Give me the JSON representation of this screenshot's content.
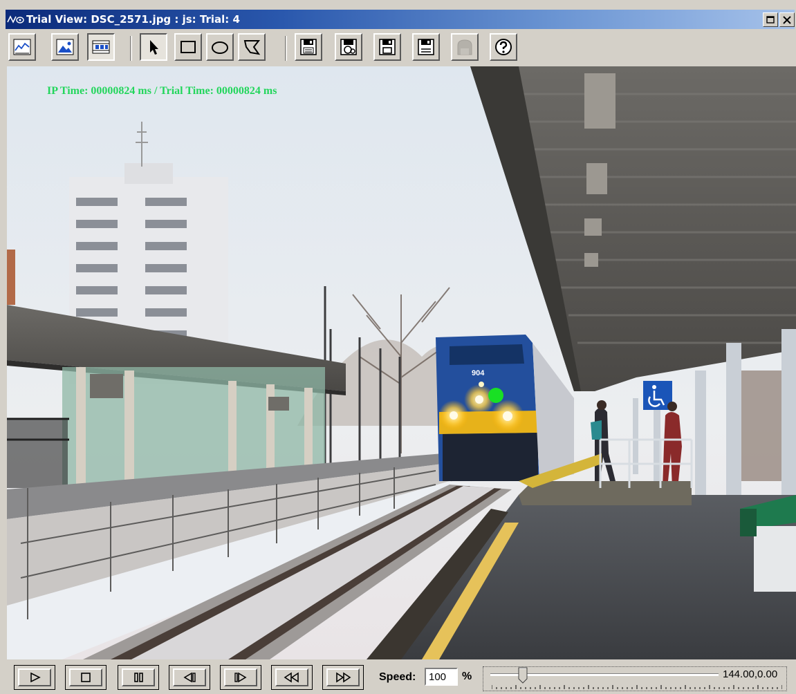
{
  "window": {
    "title": "Trial View: DSC_2571.jpg : js: Trial: 4",
    "icon": "eye-wave-icon"
  },
  "toolbar": {
    "buttons": [
      {
        "name": "chart-view-button",
        "icon": "line-chart-icon"
      },
      {
        "name": "image-view-button",
        "icon": "image-icon"
      },
      {
        "name": "film-view-button",
        "icon": "film-strip-icon"
      },
      {
        "name": "select-tool-button",
        "icon": "arrow-cursor-icon"
      },
      {
        "name": "rectangle-tool-button",
        "icon": "rectangle-icon"
      },
      {
        "name": "ellipse-tool-button",
        "icon": "ellipse-icon"
      },
      {
        "name": "polygon-tool-button",
        "icon": "polygon-icon"
      },
      {
        "name": "save-image-button",
        "icon": "save-icon"
      },
      {
        "name": "save-movie-button",
        "icon": "save-icon"
      },
      {
        "name": "save-data-button",
        "icon": "save-icon"
      },
      {
        "name": "save-as-button",
        "icon": "save-icon"
      },
      {
        "name": "disabled-tool-button",
        "icon": "building-icon"
      },
      {
        "name": "help-button",
        "icon": "help-icon"
      }
    ]
  },
  "overlay": {
    "time_text": "IP Time: 00000824 ms  /  Trial Time: 00000824 ms",
    "gaze_color": "#19e024",
    "text_color": "#23d65c"
  },
  "playback": {
    "speed_label": "Speed:",
    "speed_value": "100",
    "percent": "%",
    "slider_value": "144.00,0.00"
  }
}
